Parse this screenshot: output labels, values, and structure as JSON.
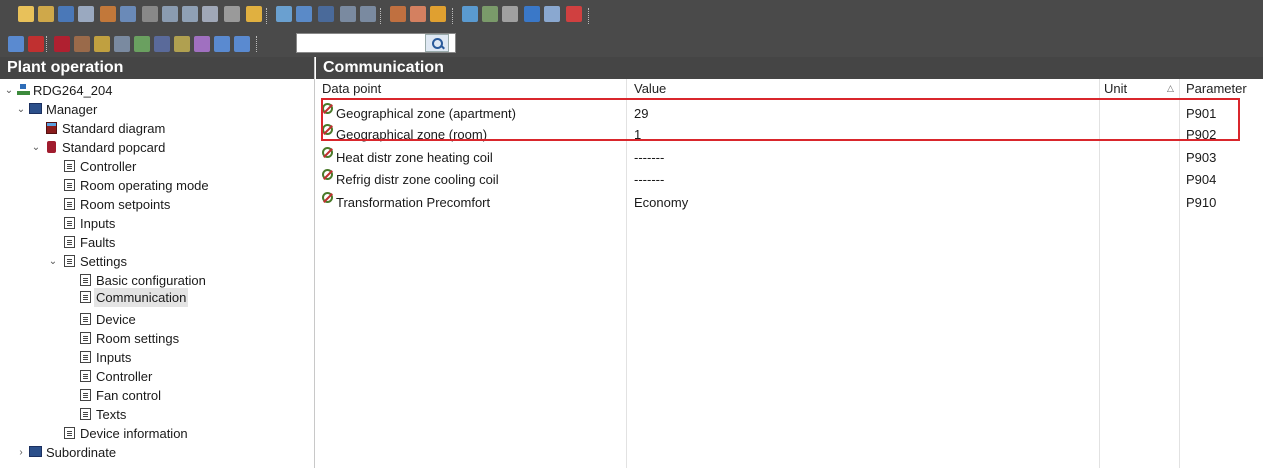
{
  "toolbar": {
    "search": {
      "value": ""
    }
  },
  "left_panel": {
    "title": "Plant operation",
    "tree": [
      {
        "label": "RDG264_204",
        "icon": "device-tree-icon"
      },
      {
        "label": "Manager",
        "icon": "manager-icon"
      },
      {
        "label": "Standard diagram",
        "icon": "diagram-icon"
      },
      {
        "label": "Standard popcard",
        "icon": "popcard-icon"
      },
      {
        "label": "Controller",
        "icon": "page-icon"
      },
      {
        "label": "Room operating mode",
        "icon": "page-icon"
      },
      {
        "label": "Room setpoints",
        "icon": "page-icon"
      },
      {
        "label": "Inputs",
        "icon": "page-icon"
      },
      {
        "label": "Faults",
        "icon": "page-icon"
      },
      {
        "label": "Settings",
        "icon": "page-icon"
      },
      {
        "label": "Basic configuration",
        "icon": "page-icon"
      },
      {
        "label": "Communication",
        "icon": "page-icon",
        "selected": true
      },
      {
        "label": "Device",
        "icon": "page-icon"
      },
      {
        "label": "Room settings",
        "icon": "page-icon"
      },
      {
        "label": "Inputs",
        "icon": "page-icon"
      },
      {
        "label": "Controller",
        "icon": "page-icon"
      },
      {
        "label": "Fan control",
        "icon": "page-icon"
      },
      {
        "label": "Texts",
        "icon": "page-icon"
      },
      {
        "label": "Device information",
        "icon": "page-icon"
      },
      {
        "label": "Subordinate",
        "icon": "manager-icon"
      }
    ]
  },
  "main": {
    "title": "Communication",
    "columns": {
      "data_point": "Data point",
      "value": "Value",
      "unit": "Unit",
      "parameter": "Parameter"
    },
    "rows": [
      {
        "data_point": "Geographical zone (apartment)",
        "value": "29",
        "unit": "",
        "parameter": "P901"
      },
      {
        "data_point": "Geographical zone (room)",
        "value": "1",
        "unit": "",
        "parameter": "P902"
      },
      {
        "data_point": "Heat distr zone heating coil",
        "value": "-------",
        "unit": "",
        "parameter": "P903"
      },
      {
        "data_point": "Refrig distr zone cooling coil",
        "value": "-------",
        "unit": "",
        "parameter": "P904"
      },
      {
        "data_point": "Transformation Precomfort",
        "value": "Economy",
        "unit": "",
        "parameter": "P910"
      }
    ]
  },
  "colors": {
    "toolbar_bg": "#4a4a4a",
    "panel_title_bg": "#454545",
    "highlight_border": "#d9262c"
  }
}
